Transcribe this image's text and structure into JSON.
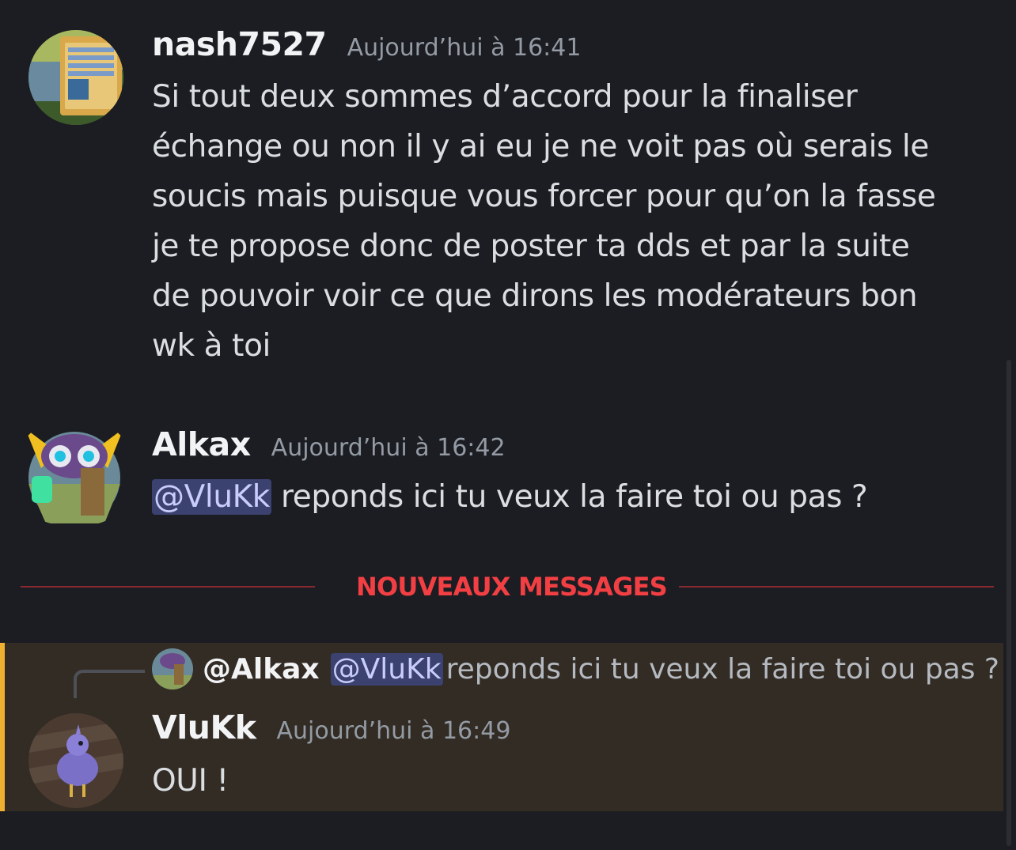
{
  "colors": {
    "background": "#1c1d22",
    "new_messages": "#f23f43",
    "mention_bg": "#3c4270",
    "highlight_bar": "#f0b132",
    "highlight_bg": "#332c25"
  },
  "messages": [
    {
      "author": "nash7527",
      "timestamp": "Aujourd’hui à 16:41",
      "avatar_icon": "game-screenshot-avatar",
      "lines": [
        "Si tout deux sommes d’accord pour la finaliser",
        "échange ou non il y ai eu je ne voit pas où serais le",
        "soucis mais puisque vous forcer pour qu’on la fasse",
        "je te propose donc de poster ta dds et par la suite",
        "de pouvoir voir ce que dirons les modérateurs bon",
        "wk à toi"
      ]
    },
    {
      "author": "Alkax",
      "timestamp": "Aujourd’hui à 16:42",
      "avatar_icon": "owl-soldier-avatar",
      "mention": "@VluKk",
      "text": " reponds ici tu veux la faire toi ou pas ?"
    },
    {
      "author": "VluKk",
      "timestamp": "Aujourd’hui à 16:49",
      "avatar_icon": "purple-bird-avatar",
      "text": "OUI !",
      "reply": {
        "author": "@Alkax",
        "mention": "@VluKk",
        "text": "reponds ici tu veux la faire toi ou pas ?"
      }
    }
  ],
  "divider": {
    "label": "NOUVEAUX MESSAGES"
  }
}
